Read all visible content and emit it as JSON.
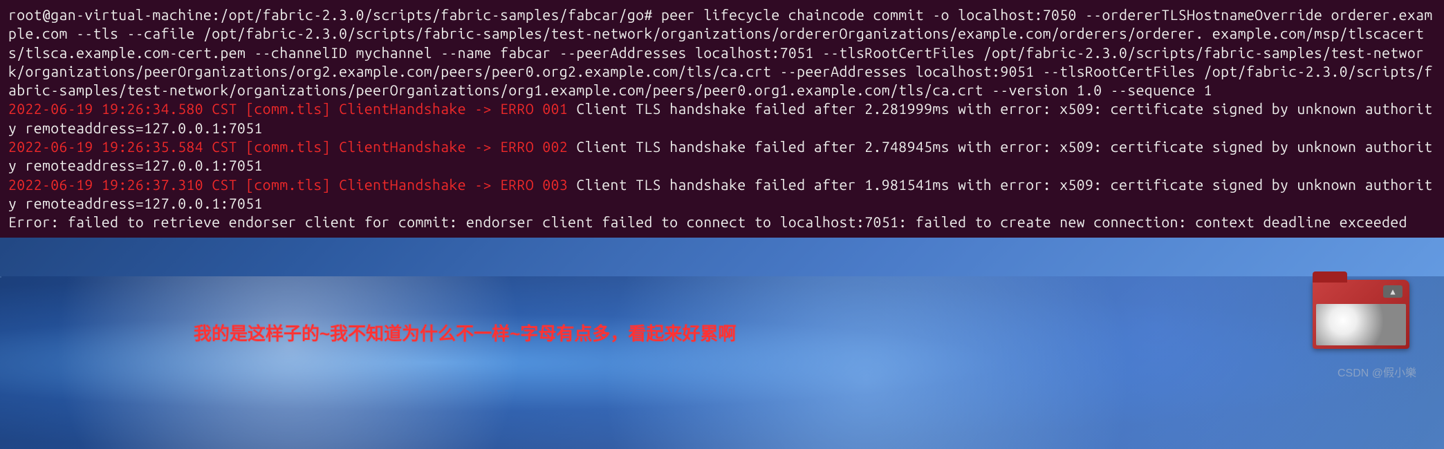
{
  "terminal": {
    "prompt": "root@gan-virtual-machine:/opt/fabric-2.3.0/scripts/fabric-samples/fabcar/go# ",
    "command": "peer lifecycle chaincode commit -o localhost:7050 --ordererTLSHostnameOverride orderer.example.com --tls --cafile /opt/fabric-2.3.0/scripts/fabric-samples/test-network/organizations/ordererOrganizations/example.com/orderers/orderer. example.com/msp/tlscacerts/tlsca.example.com-cert.pem --channelID mychannel --name fabcar --peerAddresses localhost:7051 --tlsRootCertFiles /opt/fabric-2.3.0/scripts/fabric-samples/test-network/organizations/peerOrganizations/org2.example.com/peers/peer0.org2.example.com/tls/ca.crt --peerAddresses localhost:9051 --tlsRootCertFiles /opt/fabric-2.3.0/scripts/fabric-samples/test-network/organizations/peerOrganizations/org1.example.com/peers/peer0.org1.example.com/tls/ca.crt --version 1.0 --sequence 1",
    "errors": [
      {
        "prefix": "2022-06-19 19:26:34.580 CST [comm.tls] ClientHandshake -> ERRO 001",
        "message": " Client TLS handshake failed after 2.281999ms with error: x509: certificate signed by unknown authority remoteaddress=127.0.0.1:7051"
      },
      {
        "prefix": "2022-06-19 19:26:35.584 CST [comm.tls] ClientHandshake -> ERRO 002",
        "message": " Client TLS handshake failed after 2.748945ms with error: x509: certificate signed by unknown authority remoteaddress=127.0.0.1:7051"
      },
      {
        "prefix": "2022-06-19 19:26:37.310 CST [comm.tls] ClientHandshake -> ERRO 003",
        "message": " Client TLS handshake failed after 1.981541ms with error: x509: certificate signed by unknown authority remoteaddress=127.0.0.1:7051"
      }
    ],
    "final_error": "Error: failed to retrieve endorser client for commit: endorser client failed to connect to localhost:7051: failed to create new connection: context deadline exceeded"
  },
  "annotation": {
    "text": "我的是这样子的~我不知道为什么不一样~字母有点多，看起来好累啊"
  },
  "watermark": {
    "text": "CSDN @假小樂"
  },
  "folder": {
    "arrow": "▲"
  }
}
